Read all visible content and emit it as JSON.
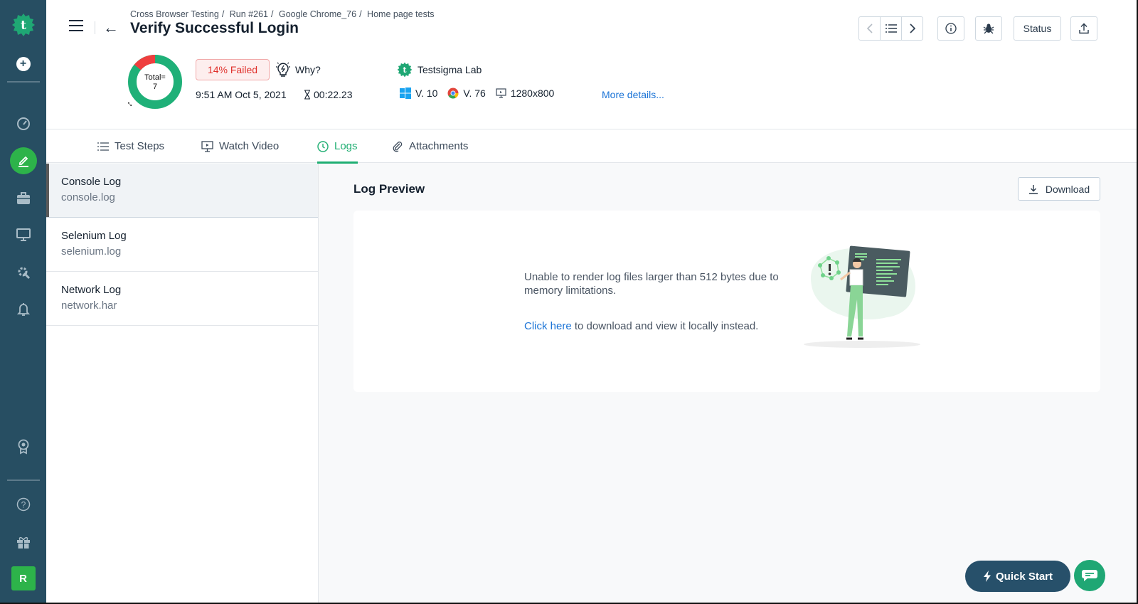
{
  "breadcrumb": [
    "Cross Browser Testing",
    "Run #261",
    "Google Chrome_76",
    "Home page tests"
  ],
  "page_title": "Verify Successful Login",
  "summary": {
    "total_label": "Total=",
    "total_value": "7",
    "failed_fraction": 0.14,
    "failed_badge": "14% Failed",
    "why_label": "Why?",
    "datetime": "9:51 AM Oct 5, 2021",
    "duration": "00:22.23",
    "lab_name": "Testsigma Lab",
    "os_version": "V. 10",
    "browser_version": "V. 76",
    "resolution": "1280x800",
    "more_details": "More details...",
    "colors": {
      "passed": "#1fb078",
      "failed": "#ef3e3e"
    }
  },
  "toolbar": {
    "prev_icon": "chevron-left-icon",
    "list_icon": "list-icon",
    "next_icon": "chevron-right-icon",
    "info_icon": "info-icon",
    "bug_icon": "bug-icon",
    "status_label": "Status",
    "share_icon": "upload-icon"
  },
  "tabs": [
    {
      "label": "Test Steps",
      "icon": "list-icon"
    },
    {
      "label": "Watch Video",
      "icon": "monitor-play-icon"
    },
    {
      "label": "Logs",
      "icon": "clock-icon",
      "active": true
    },
    {
      "label": "Attachments",
      "icon": "paperclip-icon"
    }
  ],
  "logs": [
    {
      "name": "Console Log",
      "file": "console.log",
      "active": true
    },
    {
      "name": "Selenium Log",
      "file": "selenium.log"
    },
    {
      "name": "Network Log",
      "file": "network.har"
    }
  ],
  "preview": {
    "title": "Log Preview",
    "download_label": "Download",
    "message": "Unable to render log files larger than 512 bytes due to memory limitations.",
    "link_text": "Click here",
    "link_suffix": " to download and view it locally instead."
  },
  "sidebar": {
    "items": [
      "logo",
      "add",
      "dashboard",
      "test-development",
      "test-plans",
      "devices",
      "settings",
      "notifications",
      "rewards",
      "help",
      "gifts"
    ],
    "avatar_initial": "R"
  },
  "quick_start_label": "Quick Start"
}
